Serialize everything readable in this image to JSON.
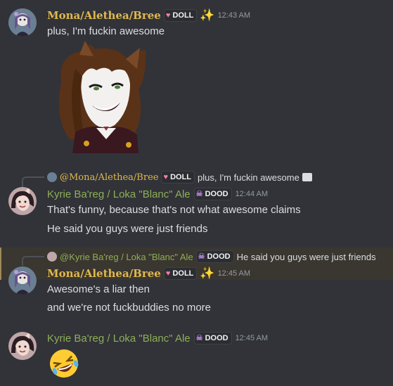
{
  "messages": [
    {
      "author": "Mona/Alethea/Bree",
      "tag": "DOLL",
      "time": "12:43 AM",
      "lines": [
        "plus, I'm fuckin awesome"
      ],
      "attachment": "image"
    },
    {
      "reply": {
        "author": "@Mona/Alethea/Bree",
        "tag": "DOLL",
        "text": "plus, I'm fuckin awesome"
      },
      "author": "Kyrie Ba'reg / Loka \"Blanc\" Ale",
      "tag": "DOOD",
      "time": "12:44 AM",
      "lines": [
        "That's funny, because that's not what awesome claims",
        "He said you guys were just friends"
      ]
    },
    {
      "reply": {
        "author": "@Kyrie Ba'reg / Loka \"Blanc\" Ale",
        "tag": "DOOD",
        "text": "He said you guys were just friends"
      },
      "author": "Mona/Alethea/Bree",
      "tag": "DOLL",
      "time": "12:45 AM",
      "lines": [
        "Awesome's a liar then",
        "and we're not fuckbuddies no more"
      ]
    },
    {
      "author": "Kyrie Ba'reg / Loka \"Blanc\" Ale",
      "tag": "DOOD",
      "time": "12:45 AM",
      "lines": [],
      "emoji": "laughing-emoji"
    }
  ],
  "colors": {
    "background": "#313338",
    "highlight": "#3a3630",
    "mona_name": "#e0b84e",
    "kyrie_name": "#8fae58",
    "doll_icon": "#f47fa4",
    "dood_icon": "#b07fd6"
  }
}
